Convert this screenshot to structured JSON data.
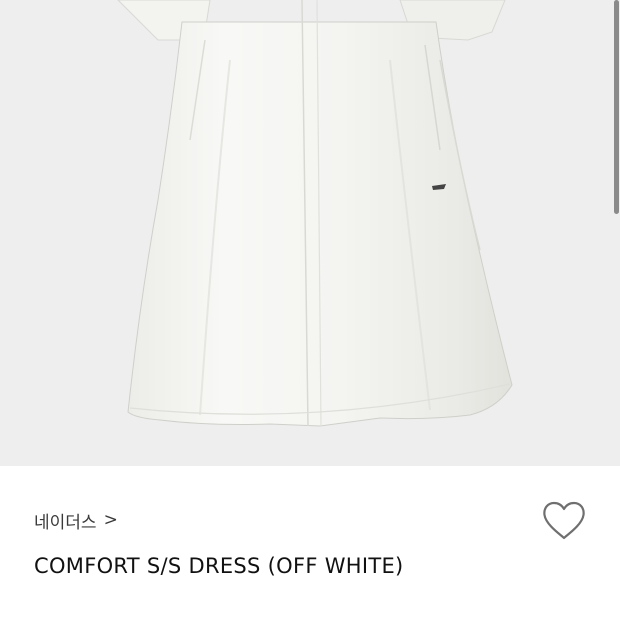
{
  "product": {
    "brand": "네이더스",
    "brand_chevron": ">",
    "title": "COMFORT S/S DRESS (OFF WHITE)"
  },
  "icons": {
    "like": "heart-outline-icon",
    "brand_link": "chevron-right-icon"
  },
  "colors": {
    "image_background": "#eeeeee",
    "garment": "#f6f6f3",
    "title_text": "#111111",
    "brand_text": "#3a3a3a",
    "heart_stroke": "#6f6f6f"
  }
}
